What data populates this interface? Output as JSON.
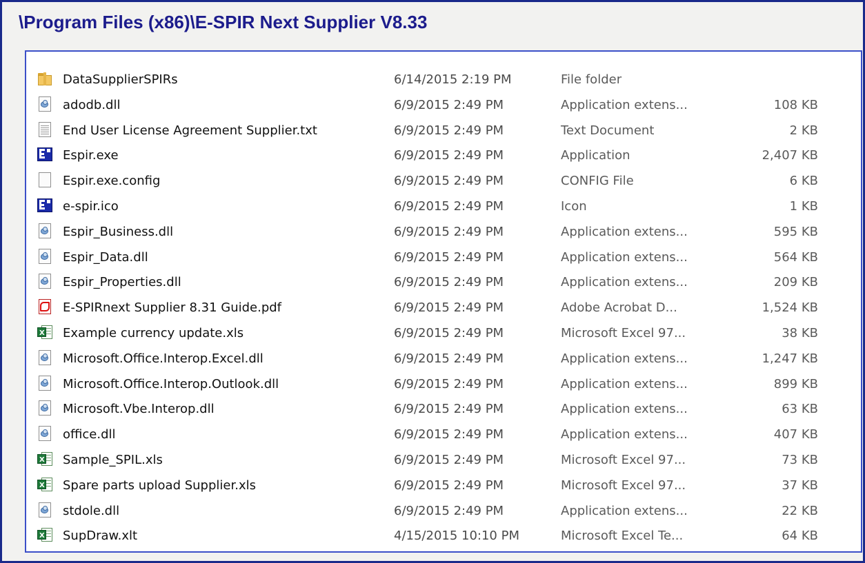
{
  "window": {
    "title": "\\Program Files (x86)\\E-SPIR Next Supplier V8.33"
  },
  "files": [
    {
      "name": "DataSupplierSPIRs",
      "date": "6/14/2015 2:19 PM",
      "type": "File folder",
      "size": "",
      "icon": "folder-icon"
    },
    {
      "name": "adodb.dll",
      "date": "6/9/2015 2:49 PM",
      "type": "Application extens...",
      "size": "108 KB",
      "icon": "dll-icon"
    },
    {
      "name": "End User License Agreement Supplier.txt",
      "date": "6/9/2015 2:49 PM",
      "type": "Text Document",
      "size": "2 KB",
      "icon": "text-file-icon"
    },
    {
      "name": "Espir.exe",
      "date": "6/9/2015 2:49 PM",
      "type": "Application",
      "size": "2,407 KB",
      "icon": "espir-app-icon"
    },
    {
      "name": "Espir.exe.config",
      "date": "6/9/2015 2:49 PM",
      "type": "CONFIG File",
      "size": "6 KB",
      "icon": "config-file-icon"
    },
    {
      "name": "e-spir.ico",
      "date": "6/9/2015 2:49 PM",
      "type": "Icon",
      "size": "1 KB",
      "icon": "espir-app-icon"
    },
    {
      "name": "Espir_Business.dll",
      "date": "6/9/2015 2:49 PM",
      "type": "Application extens...",
      "size": "595 KB",
      "icon": "dll-icon"
    },
    {
      "name": "Espir_Data.dll",
      "date": "6/9/2015 2:49 PM",
      "type": "Application extens...",
      "size": "564 KB",
      "icon": "dll-icon"
    },
    {
      "name": "Espir_Properties.dll",
      "date": "6/9/2015 2:49 PM",
      "type": "Application extens...",
      "size": "209 KB",
      "icon": "dll-icon"
    },
    {
      "name": "E-SPIRnext Supplier 8.31 Guide.pdf",
      "date": "6/9/2015 2:49 PM",
      "type": "Adobe Acrobat D...",
      "size": "1,524 KB",
      "icon": "pdf-icon"
    },
    {
      "name": "Example currency update.xls",
      "date": "6/9/2015 2:49 PM",
      "type": "Microsoft Excel 97...",
      "size": "38 KB",
      "icon": "excel-icon"
    },
    {
      "name": "Microsoft.Office.Interop.Excel.dll",
      "date": "6/9/2015 2:49 PM",
      "type": "Application extens...",
      "size": "1,247 KB",
      "icon": "dll-icon"
    },
    {
      "name": "Microsoft.Office.Interop.Outlook.dll",
      "date": "6/9/2015 2:49 PM",
      "type": "Application extens...",
      "size": "899 KB",
      "icon": "dll-icon"
    },
    {
      "name": "Microsoft.Vbe.Interop.dll",
      "date": "6/9/2015 2:49 PM",
      "type": "Application extens...",
      "size": "63 KB",
      "icon": "dll-icon"
    },
    {
      "name": "office.dll",
      "date": "6/9/2015 2:49 PM",
      "type": "Application extens...",
      "size": "407 KB",
      "icon": "dll-icon"
    },
    {
      "name": "Sample_SPIL.xls",
      "date": "6/9/2015 2:49 PM",
      "type": "Microsoft Excel 97...",
      "size": "73 KB",
      "icon": "excel-icon"
    },
    {
      "name": "Spare parts upload Supplier.xls",
      "date": "6/9/2015 2:49 PM",
      "type": "Microsoft Excel 97...",
      "size": "37 KB",
      "icon": "excel-icon"
    },
    {
      "name": "stdole.dll",
      "date": "6/9/2015 2:49 PM",
      "type": "Application extens...",
      "size": "22 KB",
      "icon": "dll-icon"
    },
    {
      "name": "SupDraw.xlt",
      "date": "4/15/2015 10:10 PM",
      "type": "Microsoft Excel Te...",
      "size": "64 KB",
      "icon": "excel-icon"
    }
  ],
  "colors": {
    "title": "#1c1c8c",
    "frame_border": "#1a2a8a",
    "explorer_border": "#3b4fc8"
  }
}
